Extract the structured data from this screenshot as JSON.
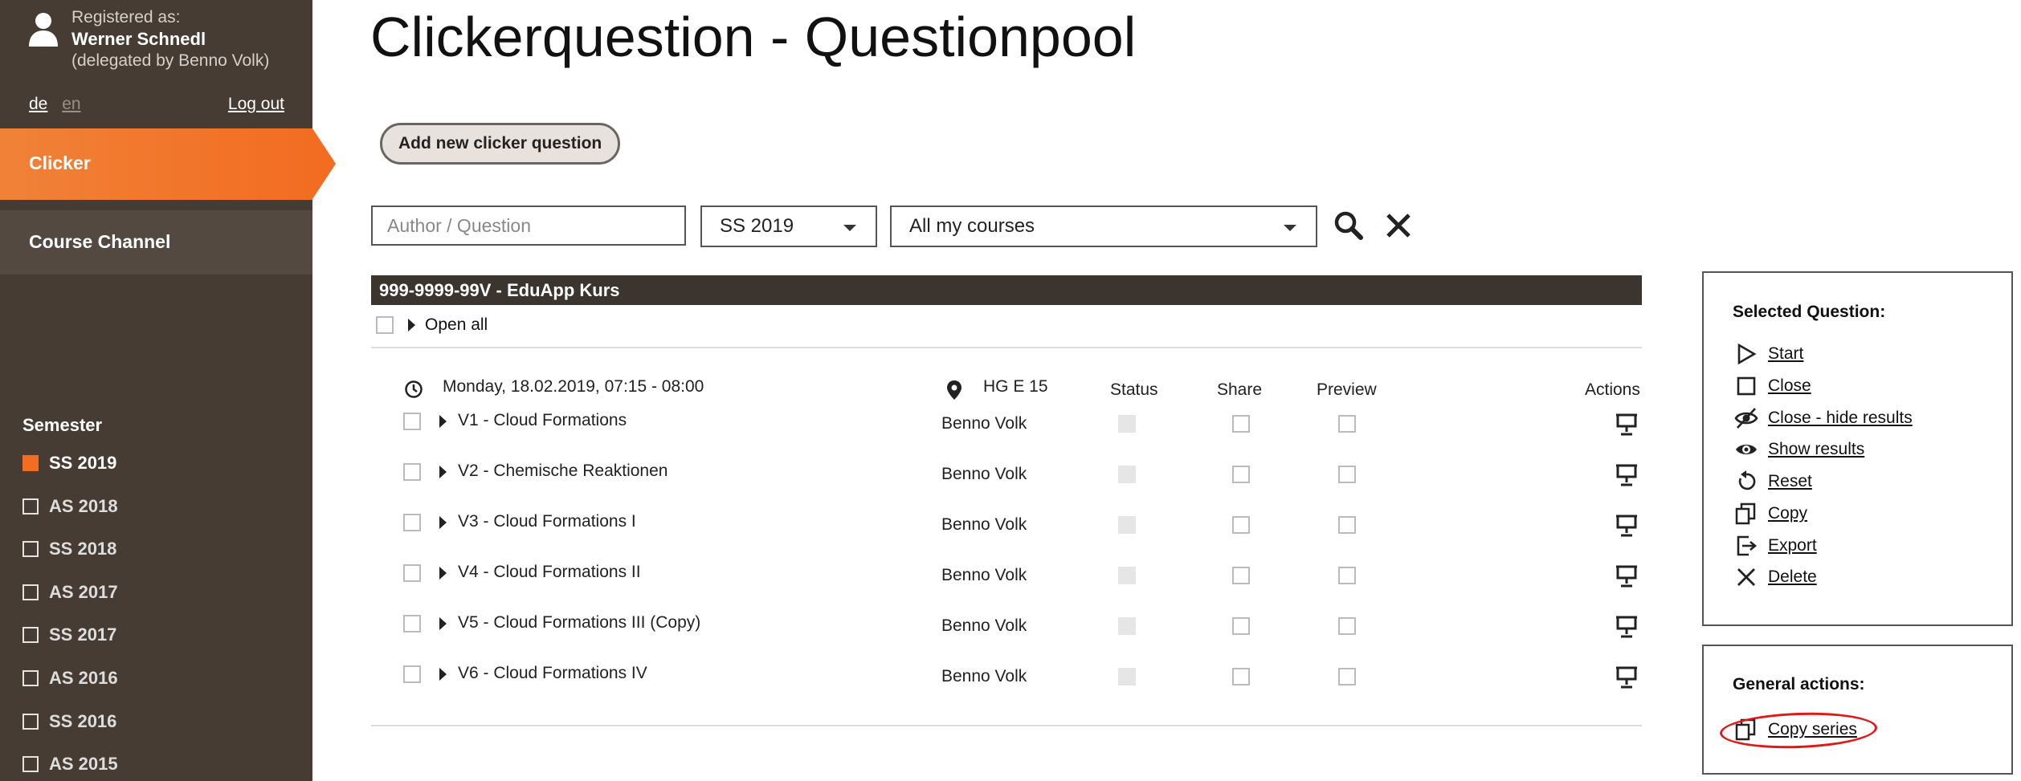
{
  "user": {
    "registered_label": "Registered as:",
    "name": "Werner Schnedl",
    "delegated": "(delegated by Benno Volk)"
  },
  "lang": {
    "de": "de",
    "en": "en",
    "active": "de"
  },
  "logout": "Log out",
  "nav": {
    "clicker": "Clicker",
    "course_channel": "Course Channel"
  },
  "semester": {
    "title": "Semester",
    "items": [
      {
        "label": "SS 2019",
        "checked": true
      },
      {
        "label": "AS 2018",
        "checked": false
      },
      {
        "label": "SS 2018",
        "checked": false
      },
      {
        "label": "AS 2017",
        "checked": false
      },
      {
        "label": "SS 2017",
        "checked": false
      },
      {
        "label": "AS 2016",
        "checked": false
      },
      {
        "label": "SS 2016",
        "checked": false
      },
      {
        "label": "AS 2015",
        "checked": false
      }
    ]
  },
  "page_title": "Clickerquestion - Questionpool",
  "add_button": "Add new clicker question",
  "filters": {
    "search_placeholder": "Author / Question",
    "semester_value": "SS 2019",
    "course_value": "All my courses"
  },
  "course": {
    "name": "999-9999-99V - EduApp Kurs",
    "open_all": "Open all",
    "session": {
      "date": "Monday, 18.02.2019, 07:15 - 08:00",
      "room": "HG E 15"
    },
    "columns": {
      "status": "Status",
      "share": "Share",
      "preview": "Preview",
      "actions": "Actions"
    },
    "questions": [
      {
        "title": "V1 - Cloud Formations",
        "author": "Benno Volk"
      },
      {
        "title": "V2 - Chemische Reaktionen",
        "author": "Benno Volk"
      },
      {
        "title": "V3 - Cloud Formations I",
        "author": "Benno Volk"
      },
      {
        "title": "V4 - Cloud Formations II",
        "author": "Benno Volk"
      },
      {
        "title": "V5 - Cloud Formations III (Copy)",
        "author": "Benno Volk"
      },
      {
        "title": "V6 - Cloud Formations IV",
        "author": "Benno Volk"
      }
    ]
  },
  "selected_panel": {
    "title": "Selected Question:",
    "actions": [
      {
        "label": "Start",
        "icon": "play-icon"
      },
      {
        "label": "Close",
        "icon": "square-icon"
      },
      {
        "label": "Close - hide results",
        "icon": "eye-off-icon"
      },
      {
        "label": "Show results",
        "icon": "eye-icon"
      },
      {
        "label": "Reset",
        "icon": "reset-icon"
      },
      {
        "label": "Copy",
        "icon": "copy-icon"
      },
      {
        "label": "Export",
        "icon": "export-icon"
      },
      {
        "label": "Delete",
        "icon": "close-icon"
      }
    ]
  },
  "general_panel": {
    "title": "General actions:",
    "copy_series": "Copy series"
  },
  "colors": {
    "sidebar": "#473c34",
    "accent": "#f26d22",
    "course_bar": "#3c342e",
    "annotation": "#e01818"
  }
}
